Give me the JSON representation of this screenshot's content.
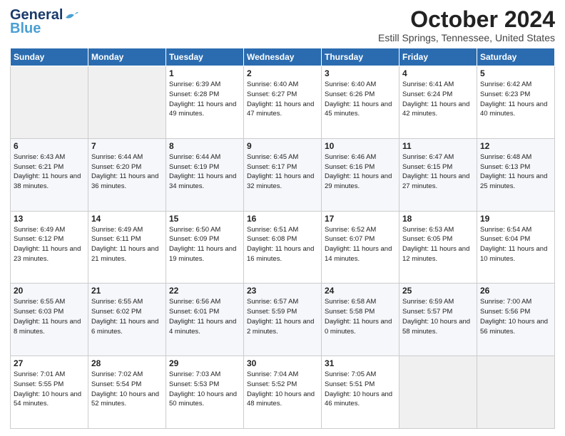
{
  "header": {
    "logo_general": "General",
    "logo_blue": "Blue",
    "month": "October 2024",
    "location": "Estill Springs, Tennessee, United States"
  },
  "days_of_week": [
    "Sunday",
    "Monday",
    "Tuesday",
    "Wednesday",
    "Thursday",
    "Friday",
    "Saturday"
  ],
  "weeks": [
    [
      {
        "day": "",
        "sunrise": "",
        "sunset": "",
        "daylight": "",
        "empty": true
      },
      {
        "day": "",
        "sunrise": "",
        "sunset": "",
        "daylight": "",
        "empty": true
      },
      {
        "day": "1",
        "sunrise": "Sunrise: 6:39 AM",
        "sunset": "Sunset: 6:28 PM",
        "daylight": "Daylight: 11 hours and 49 minutes."
      },
      {
        "day": "2",
        "sunrise": "Sunrise: 6:40 AM",
        "sunset": "Sunset: 6:27 PM",
        "daylight": "Daylight: 11 hours and 47 minutes."
      },
      {
        "day": "3",
        "sunrise": "Sunrise: 6:40 AM",
        "sunset": "Sunset: 6:26 PM",
        "daylight": "Daylight: 11 hours and 45 minutes."
      },
      {
        "day": "4",
        "sunrise": "Sunrise: 6:41 AM",
        "sunset": "Sunset: 6:24 PM",
        "daylight": "Daylight: 11 hours and 42 minutes."
      },
      {
        "day": "5",
        "sunrise": "Sunrise: 6:42 AM",
        "sunset": "Sunset: 6:23 PM",
        "daylight": "Daylight: 11 hours and 40 minutes."
      }
    ],
    [
      {
        "day": "6",
        "sunrise": "Sunrise: 6:43 AM",
        "sunset": "Sunset: 6:21 PM",
        "daylight": "Daylight: 11 hours and 38 minutes."
      },
      {
        "day": "7",
        "sunrise": "Sunrise: 6:44 AM",
        "sunset": "Sunset: 6:20 PM",
        "daylight": "Daylight: 11 hours and 36 minutes."
      },
      {
        "day": "8",
        "sunrise": "Sunrise: 6:44 AM",
        "sunset": "Sunset: 6:19 PM",
        "daylight": "Daylight: 11 hours and 34 minutes."
      },
      {
        "day": "9",
        "sunrise": "Sunrise: 6:45 AM",
        "sunset": "Sunset: 6:17 PM",
        "daylight": "Daylight: 11 hours and 32 minutes."
      },
      {
        "day": "10",
        "sunrise": "Sunrise: 6:46 AM",
        "sunset": "Sunset: 6:16 PM",
        "daylight": "Daylight: 11 hours and 29 minutes."
      },
      {
        "day": "11",
        "sunrise": "Sunrise: 6:47 AM",
        "sunset": "Sunset: 6:15 PM",
        "daylight": "Daylight: 11 hours and 27 minutes."
      },
      {
        "day": "12",
        "sunrise": "Sunrise: 6:48 AM",
        "sunset": "Sunset: 6:13 PM",
        "daylight": "Daylight: 11 hours and 25 minutes."
      }
    ],
    [
      {
        "day": "13",
        "sunrise": "Sunrise: 6:49 AM",
        "sunset": "Sunset: 6:12 PM",
        "daylight": "Daylight: 11 hours and 23 minutes."
      },
      {
        "day": "14",
        "sunrise": "Sunrise: 6:49 AM",
        "sunset": "Sunset: 6:11 PM",
        "daylight": "Daylight: 11 hours and 21 minutes."
      },
      {
        "day": "15",
        "sunrise": "Sunrise: 6:50 AM",
        "sunset": "Sunset: 6:09 PM",
        "daylight": "Daylight: 11 hours and 19 minutes."
      },
      {
        "day": "16",
        "sunrise": "Sunrise: 6:51 AM",
        "sunset": "Sunset: 6:08 PM",
        "daylight": "Daylight: 11 hours and 16 minutes."
      },
      {
        "day": "17",
        "sunrise": "Sunrise: 6:52 AM",
        "sunset": "Sunset: 6:07 PM",
        "daylight": "Daylight: 11 hours and 14 minutes."
      },
      {
        "day": "18",
        "sunrise": "Sunrise: 6:53 AM",
        "sunset": "Sunset: 6:05 PM",
        "daylight": "Daylight: 11 hours and 12 minutes."
      },
      {
        "day": "19",
        "sunrise": "Sunrise: 6:54 AM",
        "sunset": "Sunset: 6:04 PM",
        "daylight": "Daylight: 11 hours and 10 minutes."
      }
    ],
    [
      {
        "day": "20",
        "sunrise": "Sunrise: 6:55 AM",
        "sunset": "Sunset: 6:03 PM",
        "daylight": "Daylight: 11 hours and 8 minutes."
      },
      {
        "day": "21",
        "sunrise": "Sunrise: 6:55 AM",
        "sunset": "Sunset: 6:02 PM",
        "daylight": "Daylight: 11 hours and 6 minutes."
      },
      {
        "day": "22",
        "sunrise": "Sunrise: 6:56 AM",
        "sunset": "Sunset: 6:01 PM",
        "daylight": "Daylight: 11 hours and 4 minutes."
      },
      {
        "day": "23",
        "sunrise": "Sunrise: 6:57 AM",
        "sunset": "Sunset: 5:59 PM",
        "daylight": "Daylight: 11 hours and 2 minutes."
      },
      {
        "day": "24",
        "sunrise": "Sunrise: 6:58 AM",
        "sunset": "Sunset: 5:58 PM",
        "daylight": "Daylight: 11 hours and 0 minutes."
      },
      {
        "day": "25",
        "sunrise": "Sunrise: 6:59 AM",
        "sunset": "Sunset: 5:57 PM",
        "daylight": "Daylight: 10 hours and 58 minutes."
      },
      {
        "day": "26",
        "sunrise": "Sunrise: 7:00 AM",
        "sunset": "Sunset: 5:56 PM",
        "daylight": "Daylight: 10 hours and 56 minutes."
      }
    ],
    [
      {
        "day": "27",
        "sunrise": "Sunrise: 7:01 AM",
        "sunset": "Sunset: 5:55 PM",
        "daylight": "Daylight: 10 hours and 54 minutes."
      },
      {
        "day": "28",
        "sunrise": "Sunrise: 7:02 AM",
        "sunset": "Sunset: 5:54 PM",
        "daylight": "Daylight: 10 hours and 52 minutes."
      },
      {
        "day": "29",
        "sunrise": "Sunrise: 7:03 AM",
        "sunset": "Sunset: 5:53 PM",
        "daylight": "Daylight: 10 hours and 50 minutes."
      },
      {
        "day": "30",
        "sunrise": "Sunrise: 7:04 AM",
        "sunset": "Sunset: 5:52 PM",
        "daylight": "Daylight: 10 hours and 48 minutes."
      },
      {
        "day": "31",
        "sunrise": "Sunrise: 7:05 AM",
        "sunset": "Sunset: 5:51 PM",
        "daylight": "Daylight: 10 hours and 46 minutes."
      },
      {
        "day": "",
        "sunrise": "",
        "sunset": "",
        "daylight": "",
        "empty": true
      },
      {
        "day": "",
        "sunrise": "",
        "sunset": "",
        "daylight": "",
        "empty": true
      }
    ]
  ]
}
